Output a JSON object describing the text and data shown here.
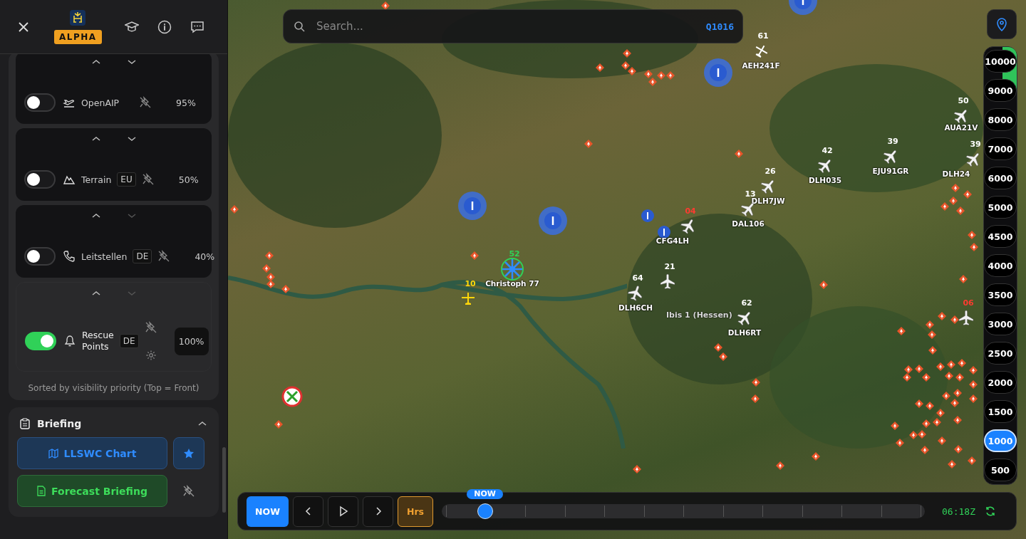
{
  "header": {
    "badge": "ALPHA"
  },
  "layers": [
    {
      "name": "OpenAIP",
      "on": false,
      "can_move_up": true,
      "can_move_down": true,
      "opacity": "95%"
    },
    {
      "name": "Terrain",
      "region": "EU",
      "on": false,
      "can_move_up": true,
      "can_move_down": true,
      "opacity": "50%"
    },
    {
      "name": "Leitstellen",
      "region": "DE",
      "on": false,
      "can_move_up": true,
      "can_move_down": false,
      "opacity": "40%"
    },
    {
      "name": "Rescue Points",
      "region": "DE",
      "on": true,
      "can_move_up": true,
      "can_move_down": false,
      "opacity": "100%"
    }
  ],
  "layers_note": "Sorted by visibility priority (Top = Front)",
  "briefing": {
    "title": "Briefing",
    "expanded": true,
    "chart_button": "LLSWC Chart",
    "chart_favorite": true,
    "forecast_button": "Forecast Briefing",
    "forecast_favorite": false
  },
  "search": {
    "placeholder": "Search...",
    "qnh": "Q1016"
  },
  "aircraft": [
    {
      "kind": "light",
      "callsign": "AEH241F",
      "altitude": "61",
      "color": "#ffffff"
    },
    {
      "kind": "airliner",
      "callsign": "DLH035",
      "altitude": "42",
      "color": "#ffffff"
    },
    {
      "kind": "airliner",
      "callsign": "EJU91GR",
      "altitude": "39",
      "color": "#ffffff"
    },
    {
      "kind": "airliner",
      "callsign": "AUA21V",
      "altitude": "50",
      "color": "#ffffff"
    },
    {
      "kind": "airliner",
      "callsign": "DLH24",
      "altitude": "39",
      "color": "#ffffff"
    },
    {
      "kind": "airliner",
      "callsign": "DLH7JW",
      "altitude": "26",
      "color": "#ffffff"
    },
    {
      "kind": "airliner",
      "callsign": "DAL106",
      "altitude": "13",
      "color": "#ffffff"
    },
    {
      "kind": "airliner",
      "callsign": "CFG4LH",
      "altitude": "04",
      "color": "#ff3b30"
    },
    {
      "kind": "airliner",
      "callsign": "DLH6CH",
      "altitude": "64",
      "color": "#ffffff"
    },
    {
      "kind": "airliner",
      "altitude": "21",
      "color": "#ffffff"
    },
    {
      "kind": "airliner",
      "callsign": "DLH6RT",
      "altitude": "62",
      "color": "#ffffff"
    },
    {
      "kind": "light",
      "altitude": "10",
      "color": "#ffd60a"
    },
    {
      "kind": "airliner",
      "altitude": "06",
      "color": "#ff3b30"
    },
    {
      "kind": "helicopter",
      "callsign": "Christoph 77",
      "altitude": "52",
      "color": "#30d158"
    }
  ],
  "map_labels": [
    "Ibis 1 (Hessen)"
  ],
  "altitude_levels": [
    {
      "label": "10000",
      "selected": false
    },
    {
      "label": "9000",
      "selected": false
    },
    {
      "label": "8000",
      "selected": false
    },
    {
      "label": "7000",
      "selected": false
    },
    {
      "label": "6000",
      "selected": false
    },
    {
      "label": "5000",
      "selected": false
    },
    {
      "label": "4500",
      "selected": false
    },
    {
      "label": "4000",
      "selected": false
    },
    {
      "label": "3500",
      "selected": false
    },
    {
      "label": "3000",
      "selected": false
    },
    {
      "label": "2500",
      "selected": false
    },
    {
      "label": "2000",
      "selected": false
    },
    {
      "label": "1500",
      "selected": false
    },
    {
      "label": "1000",
      "selected": true
    },
    {
      "label": "500",
      "selected": false
    }
  ],
  "timeline": {
    "now_button": "NOW",
    "hours_button": "Hrs",
    "marker": "NOW",
    "level": 0.09,
    "time": "06:18Z"
  }
}
